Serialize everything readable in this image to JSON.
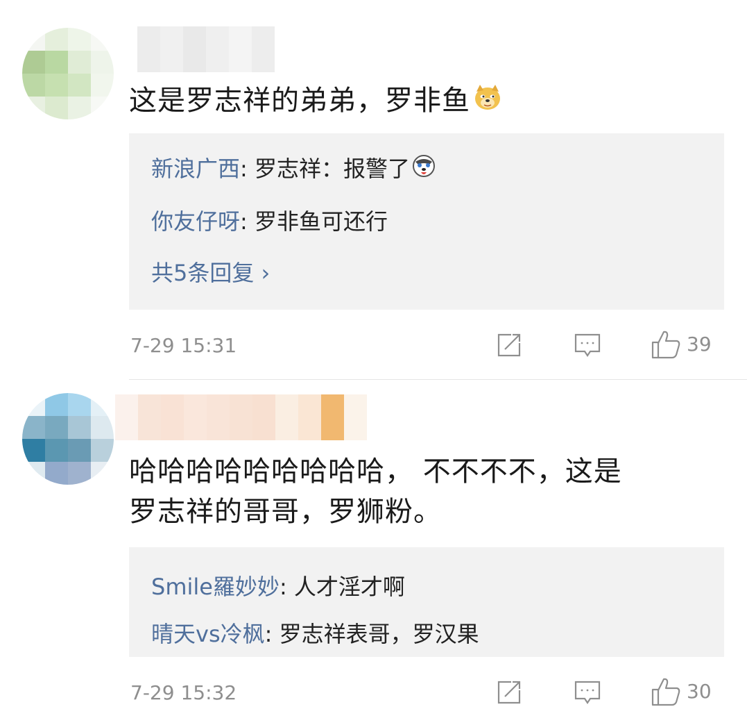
{
  "comments": [
    {
      "text": "这是罗志祥的弟弟，罗非鱼",
      "emoji": "doge-emoji",
      "replies": [
        {
          "user": "新浪广西",
          "sep": ": ",
          "text": "罗志祥：报警了",
          "emoji": "husky-emoji"
        },
        {
          "user": "你友仔呀",
          "sep": ": ",
          "text": "罗非鱼可还行"
        }
      ],
      "more_replies": "共5条回复 ›",
      "time": "7-29 15:31",
      "likes": "39",
      "icons": [
        "share-icon",
        "comment-icon",
        "like-icon"
      ]
    },
    {
      "text_line1": "哈哈哈哈哈哈哈哈哈， 不不不不，这是",
      "text_line2": "罗志祥的哥哥，罗狮粉。",
      "replies": [
        {
          "user": "Smile羅妙妙",
          "sep": ": ",
          "text": "人才淫才啊"
        },
        {
          "user": "晴天vs冷枫",
          "sep": ": ",
          "text": "罗志祥表哥，罗汉果"
        }
      ],
      "time": "7-29 15:32",
      "likes": "30",
      "icons": [
        "share-icon",
        "comment-icon",
        "like-icon"
      ]
    }
  ],
  "colors": {
    "link": "#4f6f9c",
    "meta": "#8e8e8e",
    "reply_bg": "#f2f2f2"
  }
}
